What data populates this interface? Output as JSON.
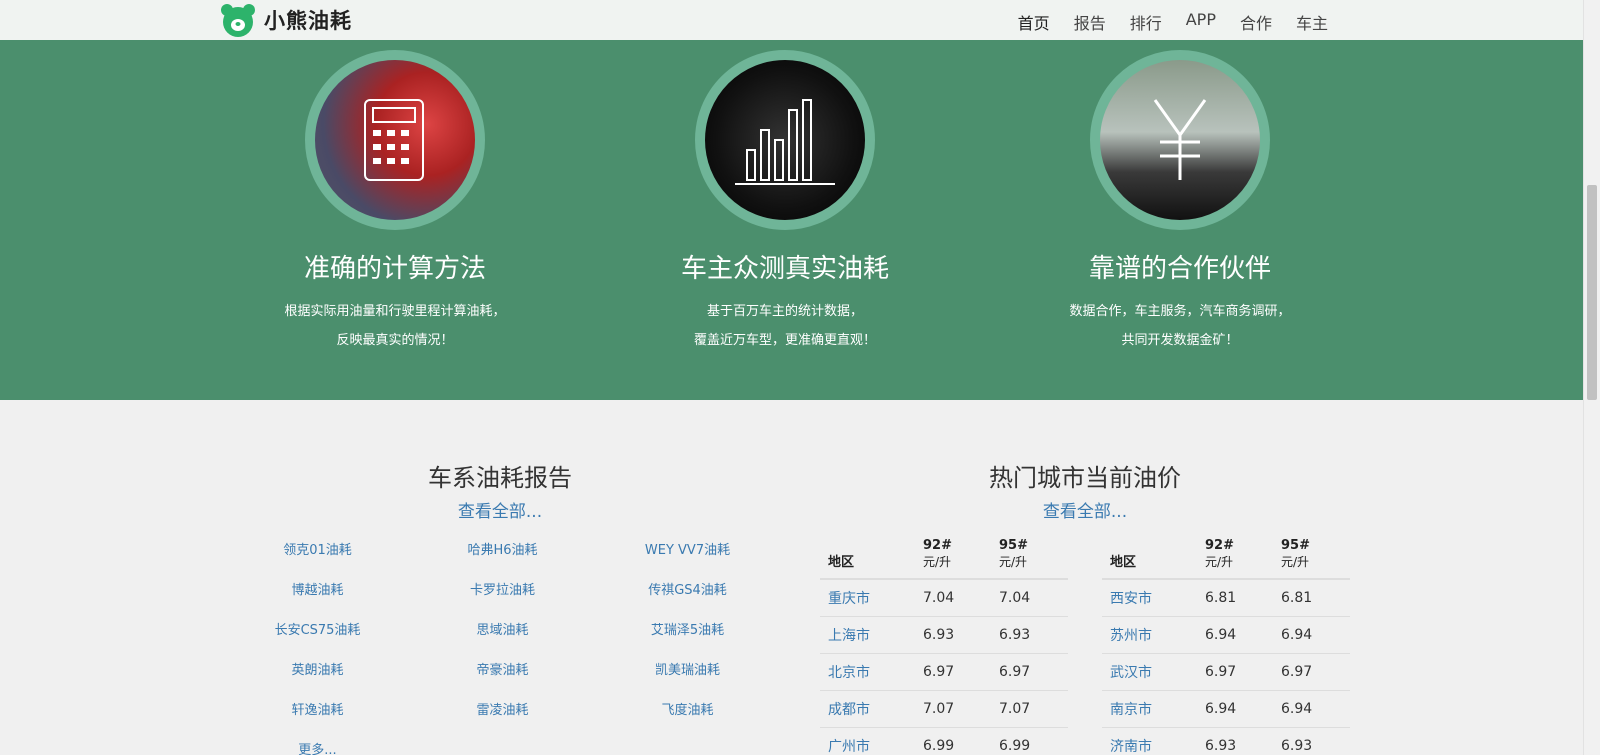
{
  "nav": {
    "logo_text": "小熊油耗",
    "links": [
      "首页",
      "报告",
      "排行",
      "APP",
      "合作",
      "车主"
    ]
  },
  "features": [
    {
      "title": "准确的计算方法",
      "line1": "根据实际用油量和行驶里程计算油耗，",
      "line2": "反映最真实的情况！"
    },
    {
      "title": "车主众测真实油耗",
      "line1": "基于百万车主的统计数据，",
      "line2": "覆盖近万车型，更准确更直观！"
    },
    {
      "title": "靠谱的合作伙伴",
      "line1": "数据合作，车主服务，汽车商务调研，",
      "line2": "共同开发数据金矿！"
    }
  ],
  "reports": {
    "title": "车系油耗报告",
    "see_all": "查看全部...",
    "items": [
      "领克01油耗",
      "哈弗H6油耗",
      "WEY VV7油耗",
      "博越油耗",
      "卡罗拉油耗",
      "传祺GS4油耗",
      "长安CS75油耗",
      "思域油耗",
      "艾瑞泽5油耗",
      "英朗油耗",
      "帝豪油耗",
      "凯美瑞油耗",
      "轩逸油耗",
      "雷凌油耗",
      "飞度油耗"
    ],
    "more": "更多..."
  },
  "prices": {
    "title": "热门城市当前油价",
    "see_all": "查看全部...",
    "headers": {
      "region": "地区",
      "g92": "92#",
      "g95": "95#",
      "unit": "元/升"
    },
    "left": [
      {
        "city": "重庆市",
        "g92": "7.04",
        "g95": "7.04"
      },
      {
        "city": "上海市",
        "g92": "6.93",
        "g95": "6.93"
      },
      {
        "city": "北京市",
        "g92": "6.97",
        "g95": "6.97"
      },
      {
        "city": "成都市",
        "g92": "7.07",
        "g95": "7.07"
      },
      {
        "city": "广州市",
        "g92": "6.99",
        "g95": "6.99"
      }
    ],
    "right": [
      {
        "city": "西安市",
        "g92": "6.81",
        "g95": "6.81"
      },
      {
        "city": "苏州市",
        "g92": "6.94",
        "g95": "6.94"
      },
      {
        "city": "武汉市",
        "g92": "6.97",
        "g95": "6.97"
      },
      {
        "city": "南京市",
        "g92": "6.94",
        "g95": "6.94"
      },
      {
        "city": "济南市",
        "g92": "6.93",
        "g95": "6.93"
      }
    ]
  },
  "colors": {
    "brand_green": "#4b8f6d",
    "link_blue": "#3a7ab0"
  }
}
